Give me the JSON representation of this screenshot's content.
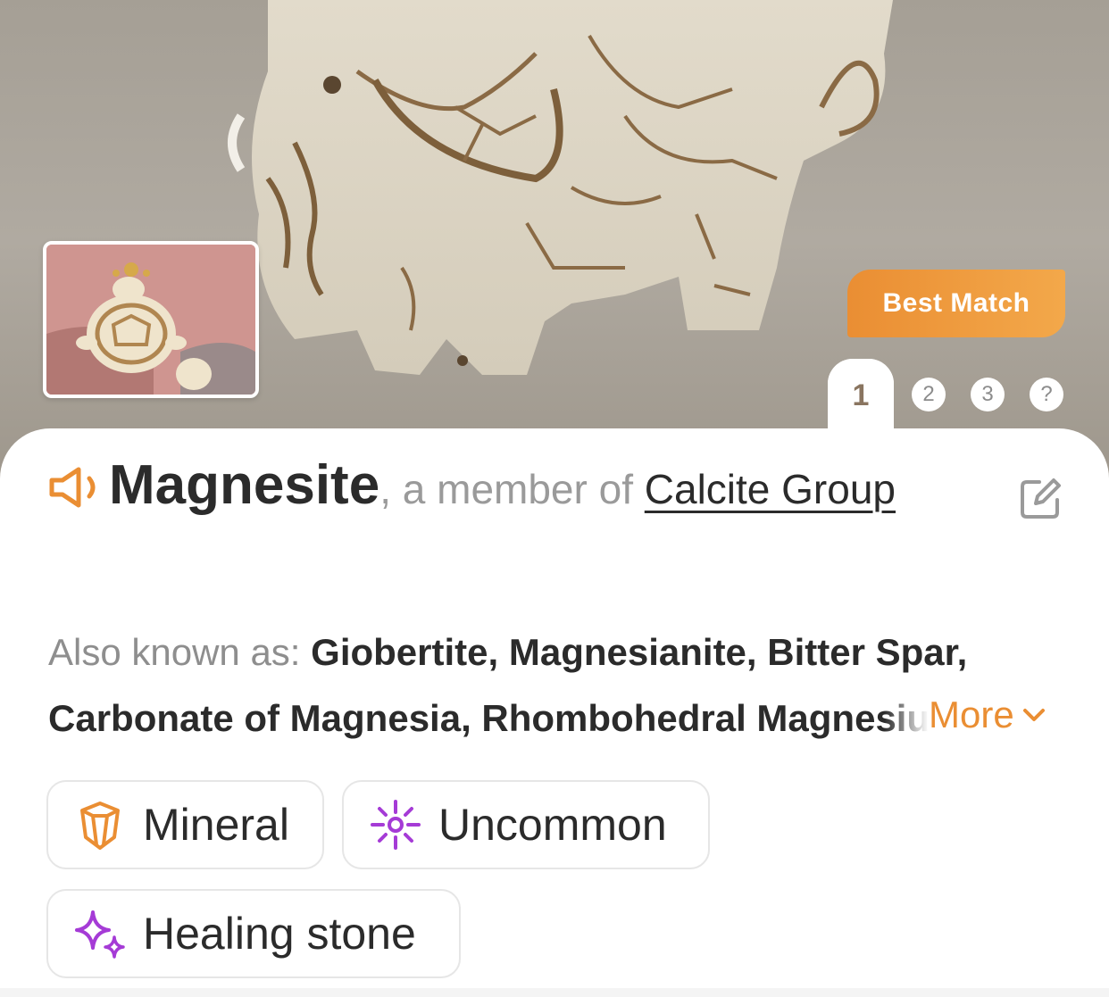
{
  "hero": {
    "badge_label": "Best Match",
    "pages": [
      {
        "label": "1",
        "active": true
      },
      {
        "label": "2",
        "active": false
      },
      {
        "label": "3",
        "active": false
      },
      {
        "label": "?",
        "active": false
      }
    ]
  },
  "result": {
    "name": "Magnesite",
    "member_text": ", a member of ",
    "group_link": "Calcite Group",
    "aka_label": "Also known as: ",
    "aka_values": "Giobertite, Magnesianite, Bitter Spar, Carbonate of Magnesia, Rhombohedral Magnesium Carbonate",
    "more_label": "More"
  },
  "tags": [
    {
      "label": "Mineral",
      "icon": "crystal-icon"
    },
    {
      "label": "Uncommon",
      "icon": "sparkle-burst-icon"
    },
    {
      "label": "Healing stone",
      "icon": "sparkles-icon"
    }
  ],
  "colors": {
    "accent": "#EA8E33",
    "purple": "#A53BD6",
    "text": "#2B2B2B",
    "muted": "#9A9A9A"
  }
}
